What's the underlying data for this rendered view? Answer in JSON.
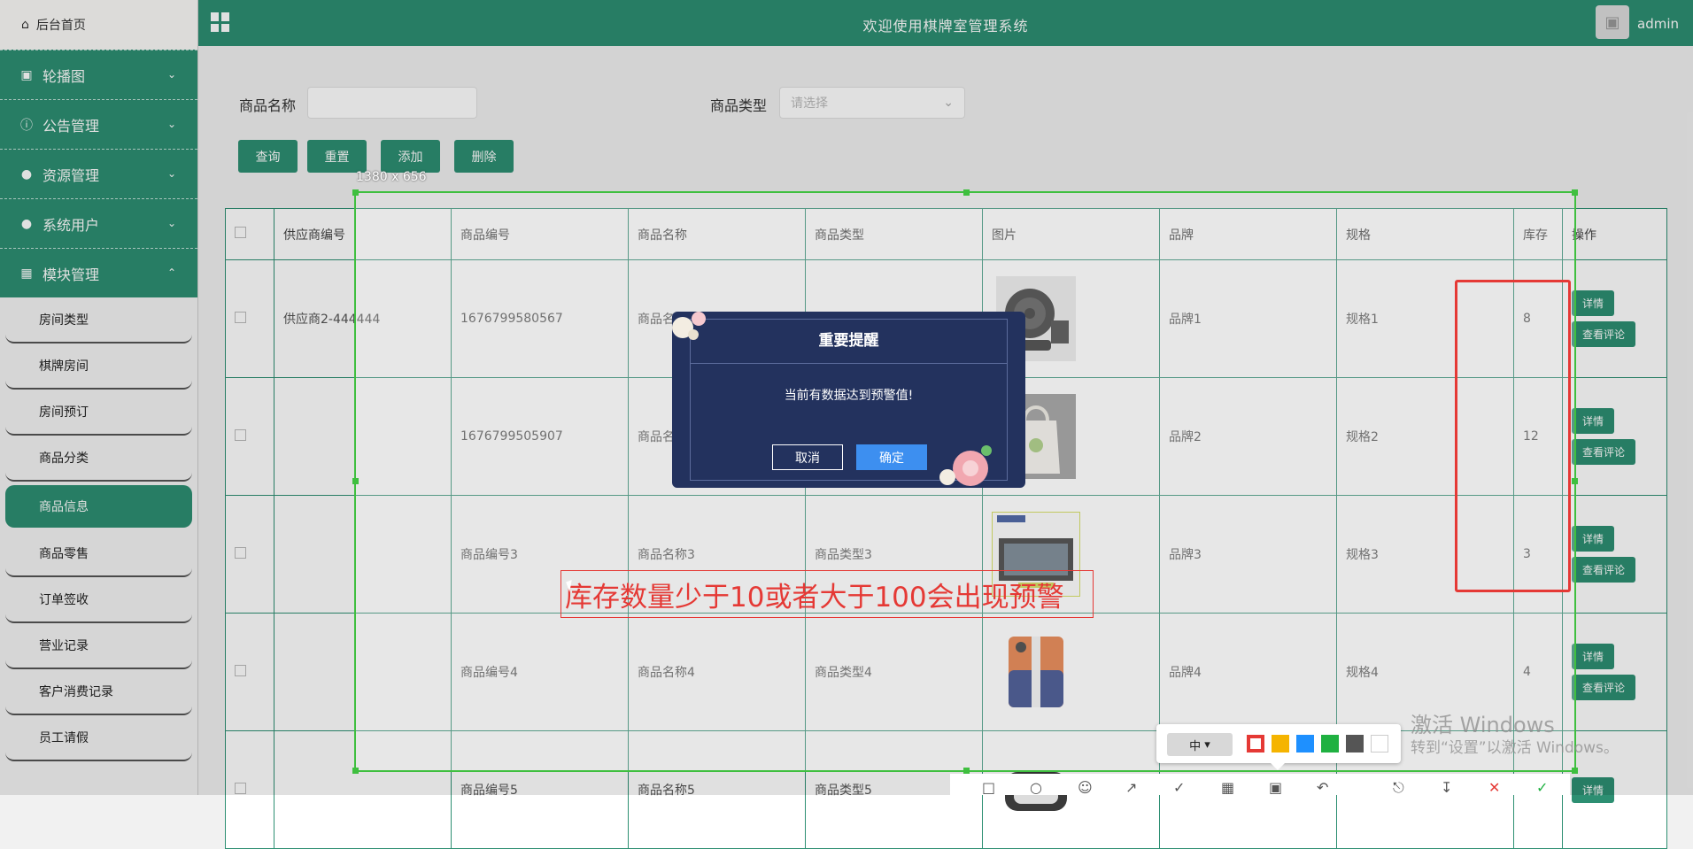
{
  "sidebar": {
    "home_label": "后台首页",
    "groups": [
      {
        "label": "轮播图",
        "icon": "image-icon"
      },
      {
        "label": "公告管理",
        "icon": "info-icon"
      },
      {
        "label": "资源管理",
        "icon": "bulb-icon"
      },
      {
        "label": "系统用户",
        "icon": "user-icon"
      },
      {
        "label": "模块管理",
        "icon": "grid-icon"
      }
    ],
    "items": [
      {
        "label": "房间类型"
      },
      {
        "label": "棋牌房间"
      },
      {
        "label": "房间预订"
      },
      {
        "label": "商品分类"
      },
      {
        "label": "商品信息"
      },
      {
        "label": "商品零售"
      },
      {
        "label": "订单签收"
      },
      {
        "label": "营业记录"
      },
      {
        "label": "客户消费记录"
      },
      {
        "label": "员工请假"
      }
    ]
  },
  "header": {
    "title": "欢迎使用棋牌室管理系统",
    "username": "admin"
  },
  "search": {
    "name_label": "商品名称",
    "name_value": "",
    "type_label": "商品类型",
    "type_placeholder": "请选择"
  },
  "buttons": {
    "query": "查询",
    "reset": "重置",
    "add": "添加",
    "delete": "删除"
  },
  "table": {
    "headers": [
      "供应商编号",
      "商品编号",
      "商品名称",
      "商品类型",
      "图片",
      "品牌",
      "规格",
      "库存",
      "操作"
    ],
    "rows": [
      {
        "supplier": "供应商2-444444",
        "code": "1676799580567",
        "name": "商品名称1",
        "type": "",
        "brand": "品牌1",
        "spec": "规格1",
        "stock": "8"
      },
      {
        "supplier": "",
        "code": "1676799505907",
        "name": "商品名称2",
        "type": "",
        "brand": "品牌2",
        "spec": "规格2",
        "stock": "12"
      },
      {
        "supplier": "",
        "code": "商品编号3",
        "name": "商品名称3",
        "type": "商品类型3",
        "brand": "品牌3",
        "spec": "规格3",
        "stock": "3"
      },
      {
        "supplier": "",
        "code": "商品编号4",
        "name": "商品名称4",
        "type": "商品类型4",
        "brand": "品牌4",
        "spec": "规格4",
        "stock": "4"
      },
      {
        "supplier": "",
        "code": "商品编号5",
        "name": "商品名称5",
        "type": "商品类型5",
        "brand": "",
        "spec": "",
        "stock": ""
      }
    ],
    "detail_label": "详情",
    "review_label": "查看评论"
  },
  "dialog": {
    "title": "重要提醒",
    "message": "当前有数据达到预警值!",
    "cancel": "取消",
    "confirm": "确定"
  },
  "annotation": {
    "size_label": "1380 x 656",
    "text": "库存数量少于10或者大于100会出现预警",
    "pen_size": "中"
  },
  "colors": {
    "accent": "#2d8f72",
    "dialog_bg": "#23325e",
    "confirm_btn": "#3d8ff0",
    "annotation_red": "#e53935",
    "swatches": [
      "#e53935",
      "#f5b400",
      "#1e90ff",
      "#1fb141",
      "#555555",
      "#ffffff"
    ]
  },
  "watermark": {
    "line1": "激活 Windows",
    "line2": "转到“设置”以激活 Windows。"
  }
}
